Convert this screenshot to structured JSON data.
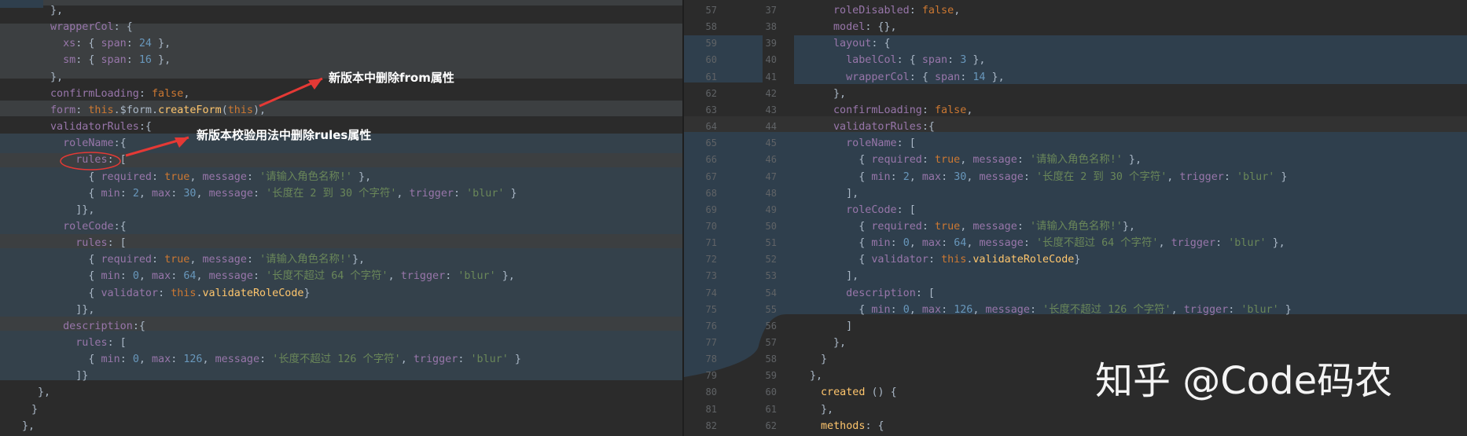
{
  "annotations": {
    "arrow1": "新版本中删除from属性",
    "arrow2": "新版本校验用法中删除rules属性"
  },
  "watermark": "知乎 @Code码农",
  "left_lines": [
    "},",
    "wrapperCol: {",
    "  xs: { span: 24 },",
    "  sm: { span: 16 },",
    "},",
    "confirmLoading: false,",
    "form: this.$form.createForm(this),",
    "validatorRules:{",
    "  roleName:{",
    "    rules: [",
    "      { required: true, message: '请输入角色名称!' },",
    "      { min: 2, max: 30, message: '长度在 2 到 30 个字符', trigger: 'blur' }",
    "    ]},",
    "  roleCode:{",
    "    rules: [",
    "      { required: true, message: '请输入角色名称!'},",
    "      { min: 0, max: 64, message: '长度不超过 64 个字符', trigger: 'blur' },",
    "      { validator: this.validateRoleCode}",
    "    ]},",
    "  description:{",
    "    rules: [",
    "      { min: 0, max: 126, message: '长度不超过 126 个字符', trigger: 'blur' }",
    "    ]}",
    "},",
    "}",
    "},",
    "..."
  ],
  "right_lines": [
    "roleDisabled: false,",
    "model: {},",
    "layout: {",
    "  labelCol: { span: 3 },",
    "  wrapperCol: { span: 14 },",
    "},",
    "confirmLoading: false,",
    "validatorRules:{",
    "  roleName: [",
    "    { required: true, message: '请输入角色名称!' },",
    "    { min: 2, max: 30, message: '长度在 2 到 30 个字符', trigger: 'blur' }",
    "  ],",
    "  roleCode: [",
    "    { required: true, message: '请输入角色名称!'},",
    "    { min: 0, max: 64, message: '长度不超过 64 个字符', trigger: 'blur' },",
    "    { validator: this.validateRoleCode}",
    "  ],",
    "  description: [",
    "    { min: 0, max: 126, message: '长度不超过 126 个字符', trigger: 'blur' }",
    "  ]",
    "},",
    "}",
    "},",
    "created () {",
    "},",
    "methods: {"
  ],
  "right_left_numbers": [
    "57",
    "58",
    "59",
    "60",
    "61",
    "62",
    "63",
    "64",
    "65",
    "66",
    "67",
    "68",
    "69",
    "70",
    "71",
    "72",
    "73",
    "74",
    "75",
    "76",
    "77",
    "78",
    "79",
    "80",
    "81",
    "82"
  ],
  "right_right_numbers": [
    "37",
    "38",
    "39",
    "40",
    "41",
    "42",
    "43",
    "44",
    "45",
    "46",
    "47",
    "48",
    "49",
    "50",
    "51",
    "52",
    "53",
    "54",
    "55",
    "56",
    "57",
    "58",
    "59",
    "60",
    "61",
    "62"
  ]
}
